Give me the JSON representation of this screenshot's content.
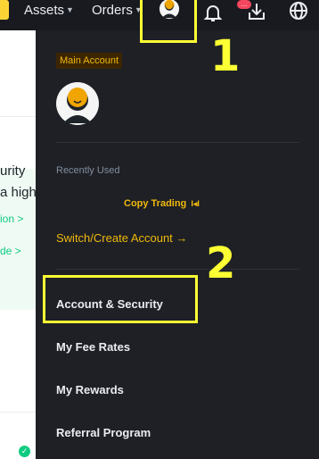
{
  "nav": {
    "assets_label": "Assets",
    "orders_label": "Orders",
    "notification_count": "..."
  },
  "background_page": {
    "text_line_1": "urity",
    "text_line_2": "a high",
    "link_1": "ion >",
    "link_2": "de >"
  },
  "account_menu": {
    "badge": "Main Account",
    "recently_used_label": "Recently Used",
    "copy_trading_label": "Copy Trading",
    "switch_account_label": "Switch/Create Account →",
    "items": [
      {
        "label": "Account & Security"
      },
      {
        "label": "My Fee Rates"
      },
      {
        "label": "My Rewards"
      },
      {
        "label": "Referral Program"
      }
    ]
  },
  "annotations": {
    "step_1": "1",
    "step_2": "2"
  },
  "colors": {
    "brand_yellow": "#f0b90b",
    "highlight": "#fcff33",
    "panel_bg": "#1e2026",
    "badge_red": "#f6465d",
    "success_green": "#0ecb81"
  }
}
